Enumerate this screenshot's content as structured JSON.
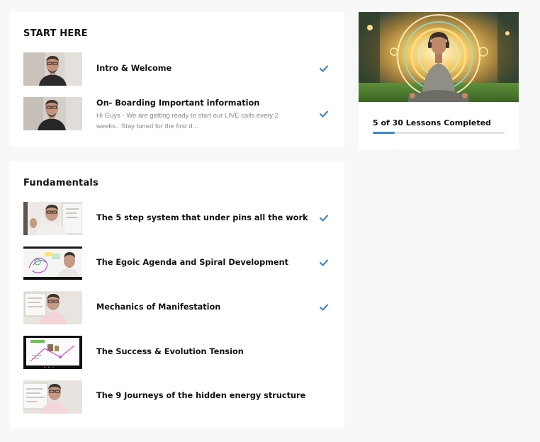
{
  "modules": [
    {
      "title": "START HERE",
      "lessons": [
        {
          "title": "Intro & Welcome",
          "description": "",
          "completed": true,
          "thumb": "presenter-talking"
        },
        {
          "title": "On- Boarding Important information",
          "description": "Hi Guys - We are getting ready to start our LIVE calls every 2 weeks.. Stay tuned for the first d...",
          "completed": true,
          "thumb": "presenter-talking"
        }
      ]
    },
    {
      "title": "Fundamentals",
      "lessons": [
        {
          "title": "The 5 step system that under pins all the work",
          "description": "",
          "completed": true,
          "thumb": "presenter-whiteboard"
        },
        {
          "title": "The Egoic Agenda and Spiral Development",
          "description": "",
          "completed": true,
          "thumb": "screen-share-diagram"
        },
        {
          "title": "Mechanics of Manifestation",
          "description": "",
          "completed": true,
          "thumb": "presenter-whiteboard"
        },
        {
          "title": "The Success & Evolution Tension",
          "description": "",
          "completed": false,
          "thumb": "screen-share-slide"
        },
        {
          "title": "The 9 Journeys of the hidden energy structure",
          "description": "",
          "completed": false,
          "thumb": "presenter-whiteboard"
        }
      ]
    }
  ],
  "progress": {
    "completed": 5,
    "total": 30,
    "text": "5 of 30 Lessons Completed",
    "fraction": 0.167,
    "bar_color": "#3f87c9",
    "image": "meditating-man-glowing-rings"
  },
  "icons": {
    "check": "checkmark-icon",
    "check_color": "#3f87c9"
  }
}
